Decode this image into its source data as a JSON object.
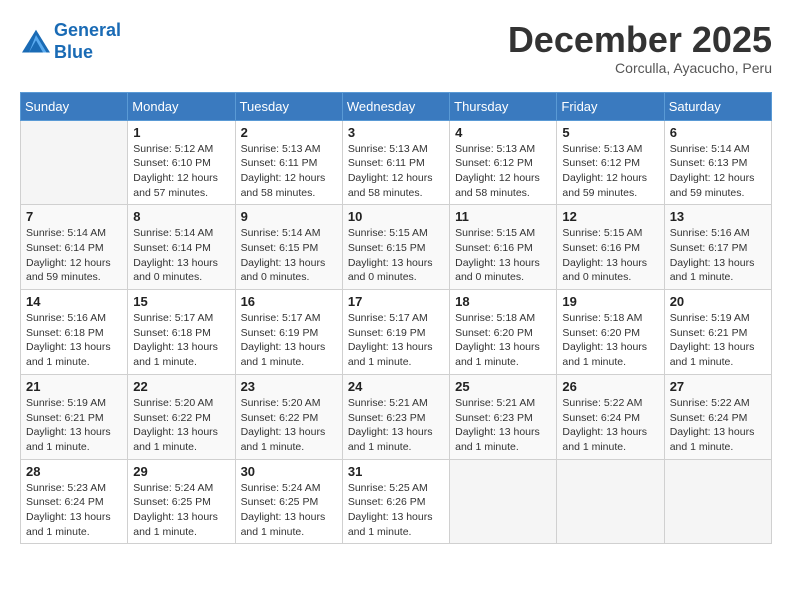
{
  "header": {
    "logo_line1": "General",
    "logo_line2": "Blue",
    "month": "December 2025",
    "location": "Corculla, Ayacucho, Peru"
  },
  "weekdays": [
    "Sunday",
    "Monday",
    "Tuesday",
    "Wednesday",
    "Thursday",
    "Friday",
    "Saturday"
  ],
  "weeks": [
    [
      {
        "day": "",
        "info": ""
      },
      {
        "day": "1",
        "info": "Sunrise: 5:12 AM\nSunset: 6:10 PM\nDaylight: 12 hours\nand 57 minutes."
      },
      {
        "day": "2",
        "info": "Sunrise: 5:13 AM\nSunset: 6:11 PM\nDaylight: 12 hours\nand 58 minutes."
      },
      {
        "day": "3",
        "info": "Sunrise: 5:13 AM\nSunset: 6:11 PM\nDaylight: 12 hours\nand 58 minutes."
      },
      {
        "day": "4",
        "info": "Sunrise: 5:13 AM\nSunset: 6:12 PM\nDaylight: 12 hours\nand 58 minutes."
      },
      {
        "day": "5",
        "info": "Sunrise: 5:13 AM\nSunset: 6:12 PM\nDaylight: 12 hours\nand 59 minutes."
      },
      {
        "day": "6",
        "info": "Sunrise: 5:14 AM\nSunset: 6:13 PM\nDaylight: 12 hours\nand 59 minutes."
      }
    ],
    [
      {
        "day": "7",
        "info": "Sunrise: 5:14 AM\nSunset: 6:14 PM\nDaylight: 12 hours\nand 59 minutes."
      },
      {
        "day": "8",
        "info": "Sunrise: 5:14 AM\nSunset: 6:14 PM\nDaylight: 13 hours\nand 0 minutes."
      },
      {
        "day": "9",
        "info": "Sunrise: 5:14 AM\nSunset: 6:15 PM\nDaylight: 13 hours\nand 0 minutes."
      },
      {
        "day": "10",
        "info": "Sunrise: 5:15 AM\nSunset: 6:15 PM\nDaylight: 13 hours\nand 0 minutes."
      },
      {
        "day": "11",
        "info": "Sunrise: 5:15 AM\nSunset: 6:16 PM\nDaylight: 13 hours\nand 0 minutes."
      },
      {
        "day": "12",
        "info": "Sunrise: 5:15 AM\nSunset: 6:16 PM\nDaylight: 13 hours\nand 0 minutes."
      },
      {
        "day": "13",
        "info": "Sunrise: 5:16 AM\nSunset: 6:17 PM\nDaylight: 13 hours\nand 1 minute."
      }
    ],
    [
      {
        "day": "14",
        "info": "Sunrise: 5:16 AM\nSunset: 6:18 PM\nDaylight: 13 hours\nand 1 minute."
      },
      {
        "day": "15",
        "info": "Sunrise: 5:17 AM\nSunset: 6:18 PM\nDaylight: 13 hours\nand 1 minute."
      },
      {
        "day": "16",
        "info": "Sunrise: 5:17 AM\nSunset: 6:19 PM\nDaylight: 13 hours\nand 1 minute."
      },
      {
        "day": "17",
        "info": "Sunrise: 5:17 AM\nSunset: 6:19 PM\nDaylight: 13 hours\nand 1 minute."
      },
      {
        "day": "18",
        "info": "Sunrise: 5:18 AM\nSunset: 6:20 PM\nDaylight: 13 hours\nand 1 minute."
      },
      {
        "day": "19",
        "info": "Sunrise: 5:18 AM\nSunset: 6:20 PM\nDaylight: 13 hours\nand 1 minute."
      },
      {
        "day": "20",
        "info": "Sunrise: 5:19 AM\nSunset: 6:21 PM\nDaylight: 13 hours\nand 1 minute."
      }
    ],
    [
      {
        "day": "21",
        "info": "Sunrise: 5:19 AM\nSunset: 6:21 PM\nDaylight: 13 hours\nand 1 minute."
      },
      {
        "day": "22",
        "info": "Sunrise: 5:20 AM\nSunset: 6:22 PM\nDaylight: 13 hours\nand 1 minute."
      },
      {
        "day": "23",
        "info": "Sunrise: 5:20 AM\nSunset: 6:22 PM\nDaylight: 13 hours\nand 1 minute."
      },
      {
        "day": "24",
        "info": "Sunrise: 5:21 AM\nSunset: 6:23 PM\nDaylight: 13 hours\nand 1 minute."
      },
      {
        "day": "25",
        "info": "Sunrise: 5:21 AM\nSunset: 6:23 PM\nDaylight: 13 hours\nand 1 minute."
      },
      {
        "day": "26",
        "info": "Sunrise: 5:22 AM\nSunset: 6:24 PM\nDaylight: 13 hours\nand 1 minute."
      },
      {
        "day": "27",
        "info": "Sunrise: 5:22 AM\nSunset: 6:24 PM\nDaylight: 13 hours\nand 1 minute."
      }
    ],
    [
      {
        "day": "28",
        "info": "Sunrise: 5:23 AM\nSunset: 6:24 PM\nDaylight: 13 hours\nand 1 minute."
      },
      {
        "day": "29",
        "info": "Sunrise: 5:24 AM\nSunset: 6:25 PM\nDaylight: 13 hours\nand 1 minute."
      },
      {
        "day": "30",
        "info": "Sunrise: 5:24 AM\nSunset: 6:25 PM\nDaylight: 13 hours\nand 1 minute."
      },
      {
        "day": "31",
        "info": "Sunrise: 5:25 AM\nSunset: 6:26 PM\nDaylight: 13 hours\nand 1 minute."
      },
      {
        "day": "",
        "info": ""
      },
      {
        "day": "",
        "info": ""
      },
      {
        "day": "",
        "info": ""
      }
    ]
  ]
}
